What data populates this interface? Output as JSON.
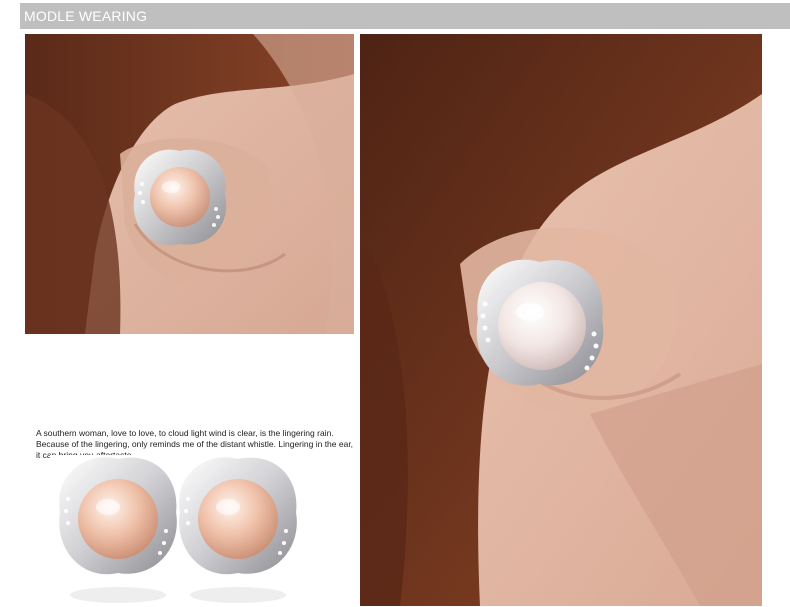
{
  "header": {
    "title": "MODLE WEARING",
    "bg_color": "#bfbfbf",
    "text_color": "#ffffff"
  },
  "images": {
    "left_photo": "model-ear-with-pink-pearl-earring",
    "right_photo": "model-ear-with-white-pearl-earring",
    "bottom_photo": "pair-of-pink-pearl-stud-earrings"
  },
  "caption": {
    "line1": "A southern woman, love to love, to cloud light wind is clear, is the lingering rain.",
    "line2": "Because of the lingering, only reminds me of the distant whistle. Lingering in the ear,",
    "line3": "it can bring you aftertaste."
  }
}
